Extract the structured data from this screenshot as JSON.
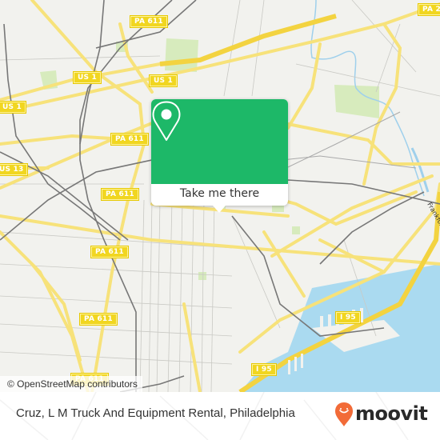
{
  "map": {
    "road_labels": [
      {
        "id": "pa611-a",
        "text": "PA 611"
      },
      {
        "id": "us1-a",
        "text": "US 1"
      },
      {
        "id": "us1-b",
        "text": "US 1"
      },
      {
        "id": "us1-c",
        "text": "US 1"
      },
      {
        "id": "pa611-b",
        "text": "PA 611"
      },
      {
        "id": "us13",
        "text": "US 13"
      },
      {
        "id": "pa611-c",
        "text": "PA 611"
      },
      {
        "id": "pa611-d",
        "text": "PA 611"
      },
      {
        "id": "pa611-e",
        "text": "PA 611"
      },
      {
        "id": "pa611-f",
        "text": "PA 611"
      },
      {
        "id": "pa2",
        "text": "PA 2"
      },
      {
        "id": "i95-a",
        "text": "I 95"
      },
      {
        "id": "i95-b",
        "text": "I 95"
      }
    ],
    "street_label": "Frankford",
    "attribution": "© OpenStreetMap contributors",
    "colors": {
      "land": "#f2f2ee",
      "major_road": "#f7e27a",
      "rail": "#777777",
      "water": "#aadaf0",
      "park": "#cfe8b0",
      "shield": "#f1d620"
    }
  },
  "popup": {
    "icon": "map-pin-icon",
    "button_label": "Take me there",
    "accent": "#1db868"
  },
  "footer": {
    "title": "Cruz, L M Truck And Equipment Rental, Philadelphia",
    "brand": "moovit",
    "brand_icon": "moovit-logo-icon",
    "brand_color": "#f26b38"
  }
}
